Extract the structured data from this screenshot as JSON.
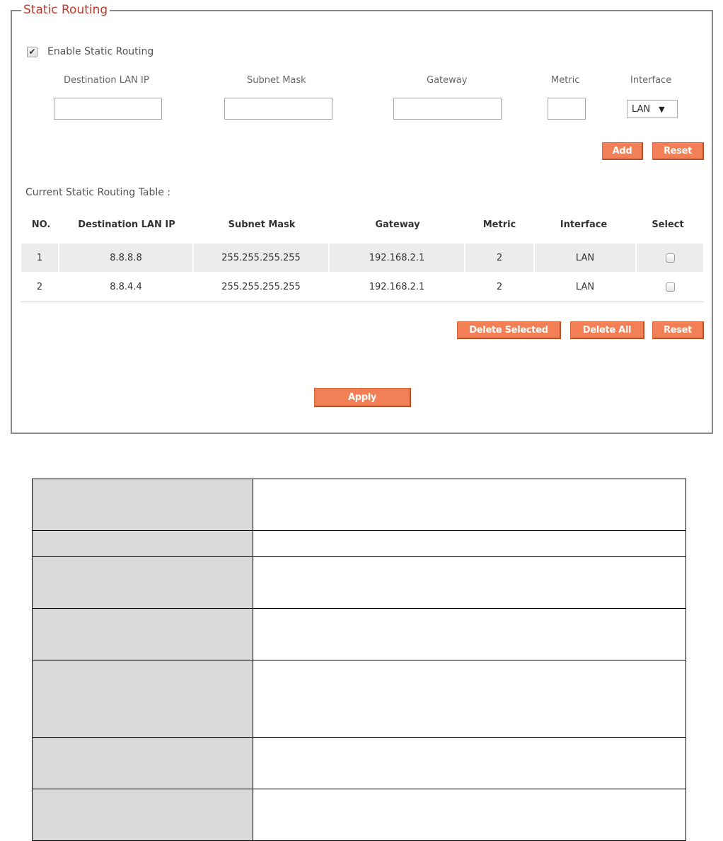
{
  "section": {
    "title": "Static Routing"
  },
  "enable": {
    "label": "Enable Static Routing",
    "checked": true
  },
  "form": {
    "labels": {
      "destination": "Destination LAN IP",
      "subnet": "Subnet Mask",
      "gateway": "Gateway",
      "metric": "Metric",
      "interface": "Interface"
    },
    "values": {
      "destination": "",
      "subnet": "",
      "gateway": "",
      "metric": ""
    },
    "interface_selected": "LAN",
    "add_label": "Add",
    "reset_label": "Reset"
  },
  "table": {
    "title": "Current Static Routing Table :",
    "headers": {
      "no": "NO.",
      "destination": "Destination LAN IP",
      "subnet": "Subnet Mask",
      "gateway": "Gateway",
      "metric": "Metric",
      "interface": "Interface",
      "select": "Select"
    },
    "rows": [
      {
        "no": "1",
        "destination": "8.8.8.8",
        "subnet": "255.255.255.255",
        "gateway": "192.168.2.1",
        "metric": "2",
        "interface": "LAN",
        "selected": false
      },
      {
        "no": "2",
        "destination": "8.8.4.4",
        "subnet": "255.255.255.255",
        "gateway": "192.168.2.1",
        "metric": "2",
        "interface": "LAN",
        "selected": false
      }
    ],
    "delete_selected_label": "Delete Selected",
    "delete_all_label": "Delete All",
    "reset_label": "Reset"
  },
  "apply_label": "Apply",
  "colors": {
    "title": "#c0392b",
    "button": "#f27f55",
    "row_shade": "#ececec",
    "desc_key_bg": "#d9d9d9"
  }
}
